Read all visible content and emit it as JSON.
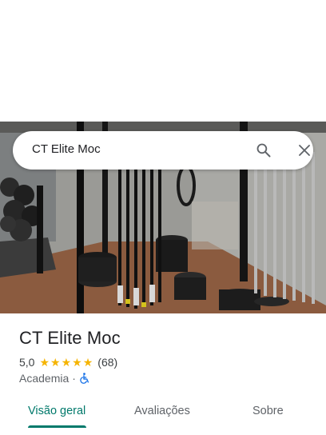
{
  "search": {
    "query": "CT Elite Moc",
    "search_icon": "search-icon",
    "close_icon": "close-icon"
  },
  "photo": {
    "subject": "gym-photo"
  },
  "place": {
    "name": "CT Elite Moc",
    "rating": "5,0",
    "stars": 5,
    "review_count": "(68)",
    "category": "Academia",
    "separator": "·",
    "accessibility_icon": "wheelchair-icon"
  },
  "tabs": [
    {
      "label": "Visão geral",
      "active": true
    },
    {
      "label": "Avaliações",
      "active": false
    },
    {
      "label": "Sobre",
      "active": false
    }
  ],
  "colors": {
    "accent": "#00796b",
    "star": "#f5b400",
    "accessibility": "#1a73e8"
  }
}
